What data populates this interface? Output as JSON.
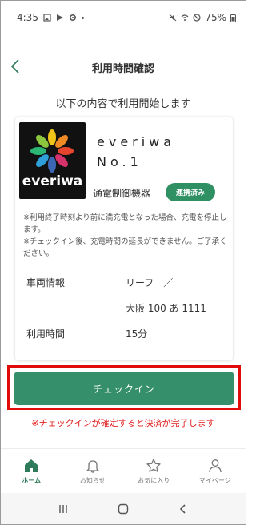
{
  "status_bar": {
    "time": "4:35",
    "battery": "75%"
  },
  "header": {
    "title": "利用時間確認"
  },
  "subtitle": "以下の内容で利用開始します",
  "card": {
    "logo_text": "everiwa",
    "device_name_line1": "everiwa",
    "device_name_line2": "No.1",
    "device_type": "通電制御機器",
    "linked_badge": "連携済み",
    "note_1": "※利用終了時刻より前に満充電となった場合、充電を停止します。",
    "note_2": "※チェックイン後、充電時間の延長ができません。ご了承ください。",
    "vehicle_label": "車両情報",
    "vehicle_model": "リーフ　／",
    "vehicle_plate": "大阪 100 あ 1111",
    "duration_label": "利用時間",
    "duration_value": "15分"
  },
  "checkin_button": "チェックイン",
  "checkin_warning": "※チェックインが確定すると決済が完了します",
  "bottom_nav": {
    "home": "ホーム",
    "notifications": "お知らせ",
    "favorites": "お気に入り",
    "mypage": "マイページ"
  },
  "colors": {
    "accent": "#358f6a",
    "highlight": "#e00b0b",
    "warning": "#e02020"
  }
}
